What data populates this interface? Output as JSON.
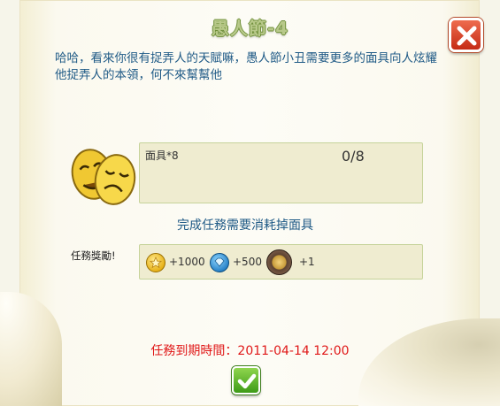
{
  "dialog": {
    "title": "愚人節-4",
    "description": "哈哈，看來你很有捉弄人的天賦嘛，愚人節小丑需要更多的面具向人炫耀他捉弄人的本領，何不來幫幫他",
    "close_icon": "close-icon"
  },
  "requirement": {
    "item_icon": "theater-mask-icon",
    "item_label": "面具*8",
    "progress": "0/8",
    "note": "完成任務需要消耗掉面具"
  },
  "reward": {
    "label": "任務獎勵!",
    "items": [
      {
        "icon": "gold-coin-icon",
        "value": "+1000"
      },
      {
        "icon": "blue-gem-icon",
        "value": "+500"
      },
      {
        "icon": "medal-icon",
        "value": "+1"
      }
    ]
  },
  "deadline": {
    "text": "任務到期時間：2011-04-14 12:00"
  },
  "confirm": {
    "icon": "checkmark-icon"
  },
  "colors": {
    "accent_blue": "#1f5a86",
    "deadline_red": "#e01818",
    "title_green": "#b8c98a",
    "panel_bg": "#efecd0"
  }
}
